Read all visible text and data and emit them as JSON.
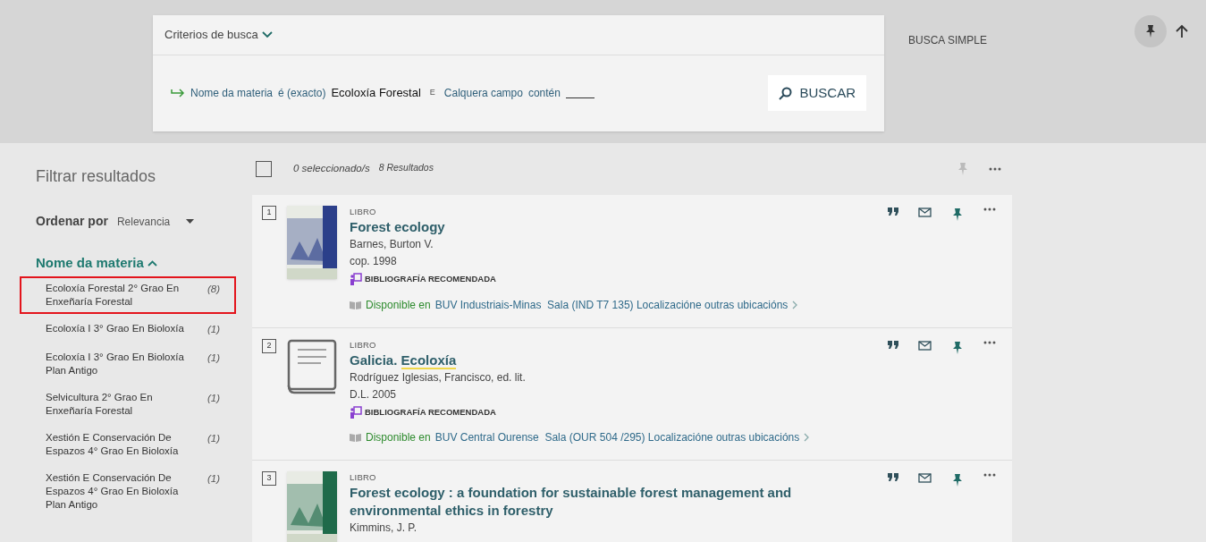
{
  "search": {
    "title": "Criterios de busca",
    "criteria": [
      {
        "field": "Nome da materia",
        "operator": "é (exacto)",
        "value": "Ecoloxía Forestal"
      },
      {
        "joiner": "E",
        "field": "Calquera campo",
        "operator": "contén"
      }
    ],
    "button": "BUSCAR"
  },
  "top_right": {
    "simple_search": "BUSCA SIMPLE",
    "pinned": true
  },
  "filters": {
    "title": "Filtrar resultados",
    "sort_label": "Ordenar por",
    "sort_value": "Relevancia",
    "facet": {
      "title": "Nome da materia",
      "expanded": true,
      "items": [
        {
          "label": "Ecoloxía Forestal 2° Grao En Enxeñaría Forestal",
          "count": "(8)",
          "highlighted": true
        },
        {
          "label": "Ecoloxía I 3° Grao En Bioloxía",
          "count": "(1)",
          "highlighted": false
        },
        {
          "label": "Ecoloxía I 3° Grao En Bioloxía Plan Antigo",
          "count": "(1)",
          "highlighted": false
        },
        {
          "label": "Selvicultura 2° Grao En Enxeñaría Forestal",
          "count": "(1)",
          "highlighted": false
        },
        {
          "label": "Xestión E Conservación De Espazos 4° Grao En Bioloxía",
          "count": "(1)",
          "highlighted": false
        },
        {
          "label": "Xestión E Conservación De Espazos 4° Grao En Bioloxía Plan Antigo",
          "count": "(1)",
          "highlighted": false
        }
      ]
    }
  },
  "results_bar": {
    "selected": "0 seleccionado/s",
    "count": "8 Resultados",
    "all_checked": false
  },
  "results": [
    {
      "number": "1",
      "cover": {
        "kind": "picture",
        "color": "#2c3f8a"
      },
      "type": "LIBRO",
      "title": [
        {
          "text": "Forest ecology",
          "highlighted": false
        }
      ],
      "lines": [
        "Barnes, Burton V.",
        "cop. 1998"
      ],
      "tag": "BIBLIOGRAFÍA RECOMENDADA",
      "status": "Disponible en",
      "location": "BUV Industriais-Minas  Sala (IND T7 135) Localizacióne outras ubicacións",
      "pinned": true
    },
    {
      "number": "2",
      "cover": {
        "kind": "placeholder"
      },
      "type": "LIBRO",
      "title": [
        {
          "text": "Galicia. ",
          "highlighted": false
        },
        {
          "text": "Ecoloxía",
          "highlighted": true
        }
      ],
      "lines": [
        "Rodríguez Iglesias, Francisco, ed. lit.",
        "D.L. 2005"
      ],
      "tag": "BIBLIOGRAFÍA RECOMENDADA",
      "status": "Disponible en",
      "location": "BUV Central Ourense  Sala (OUR 504 /295) Localizacióne outras ubicacións",
      "pinned": true
    },
    {
      "number": "3",
      "cover": {
        "kind": "picture",
        "color": "#1f6b4a"
      },
      "type": "LIBRO",
      "title": [
        {
          "text": "Forest ecology : a foundation for sustainable forest management and environmental ethics in forestry",
          "highlighted": false
        }
      ],
      "lines": [
        "Kimmins, J. P."
      ],
      "pinned": true
    }
  ]
}
